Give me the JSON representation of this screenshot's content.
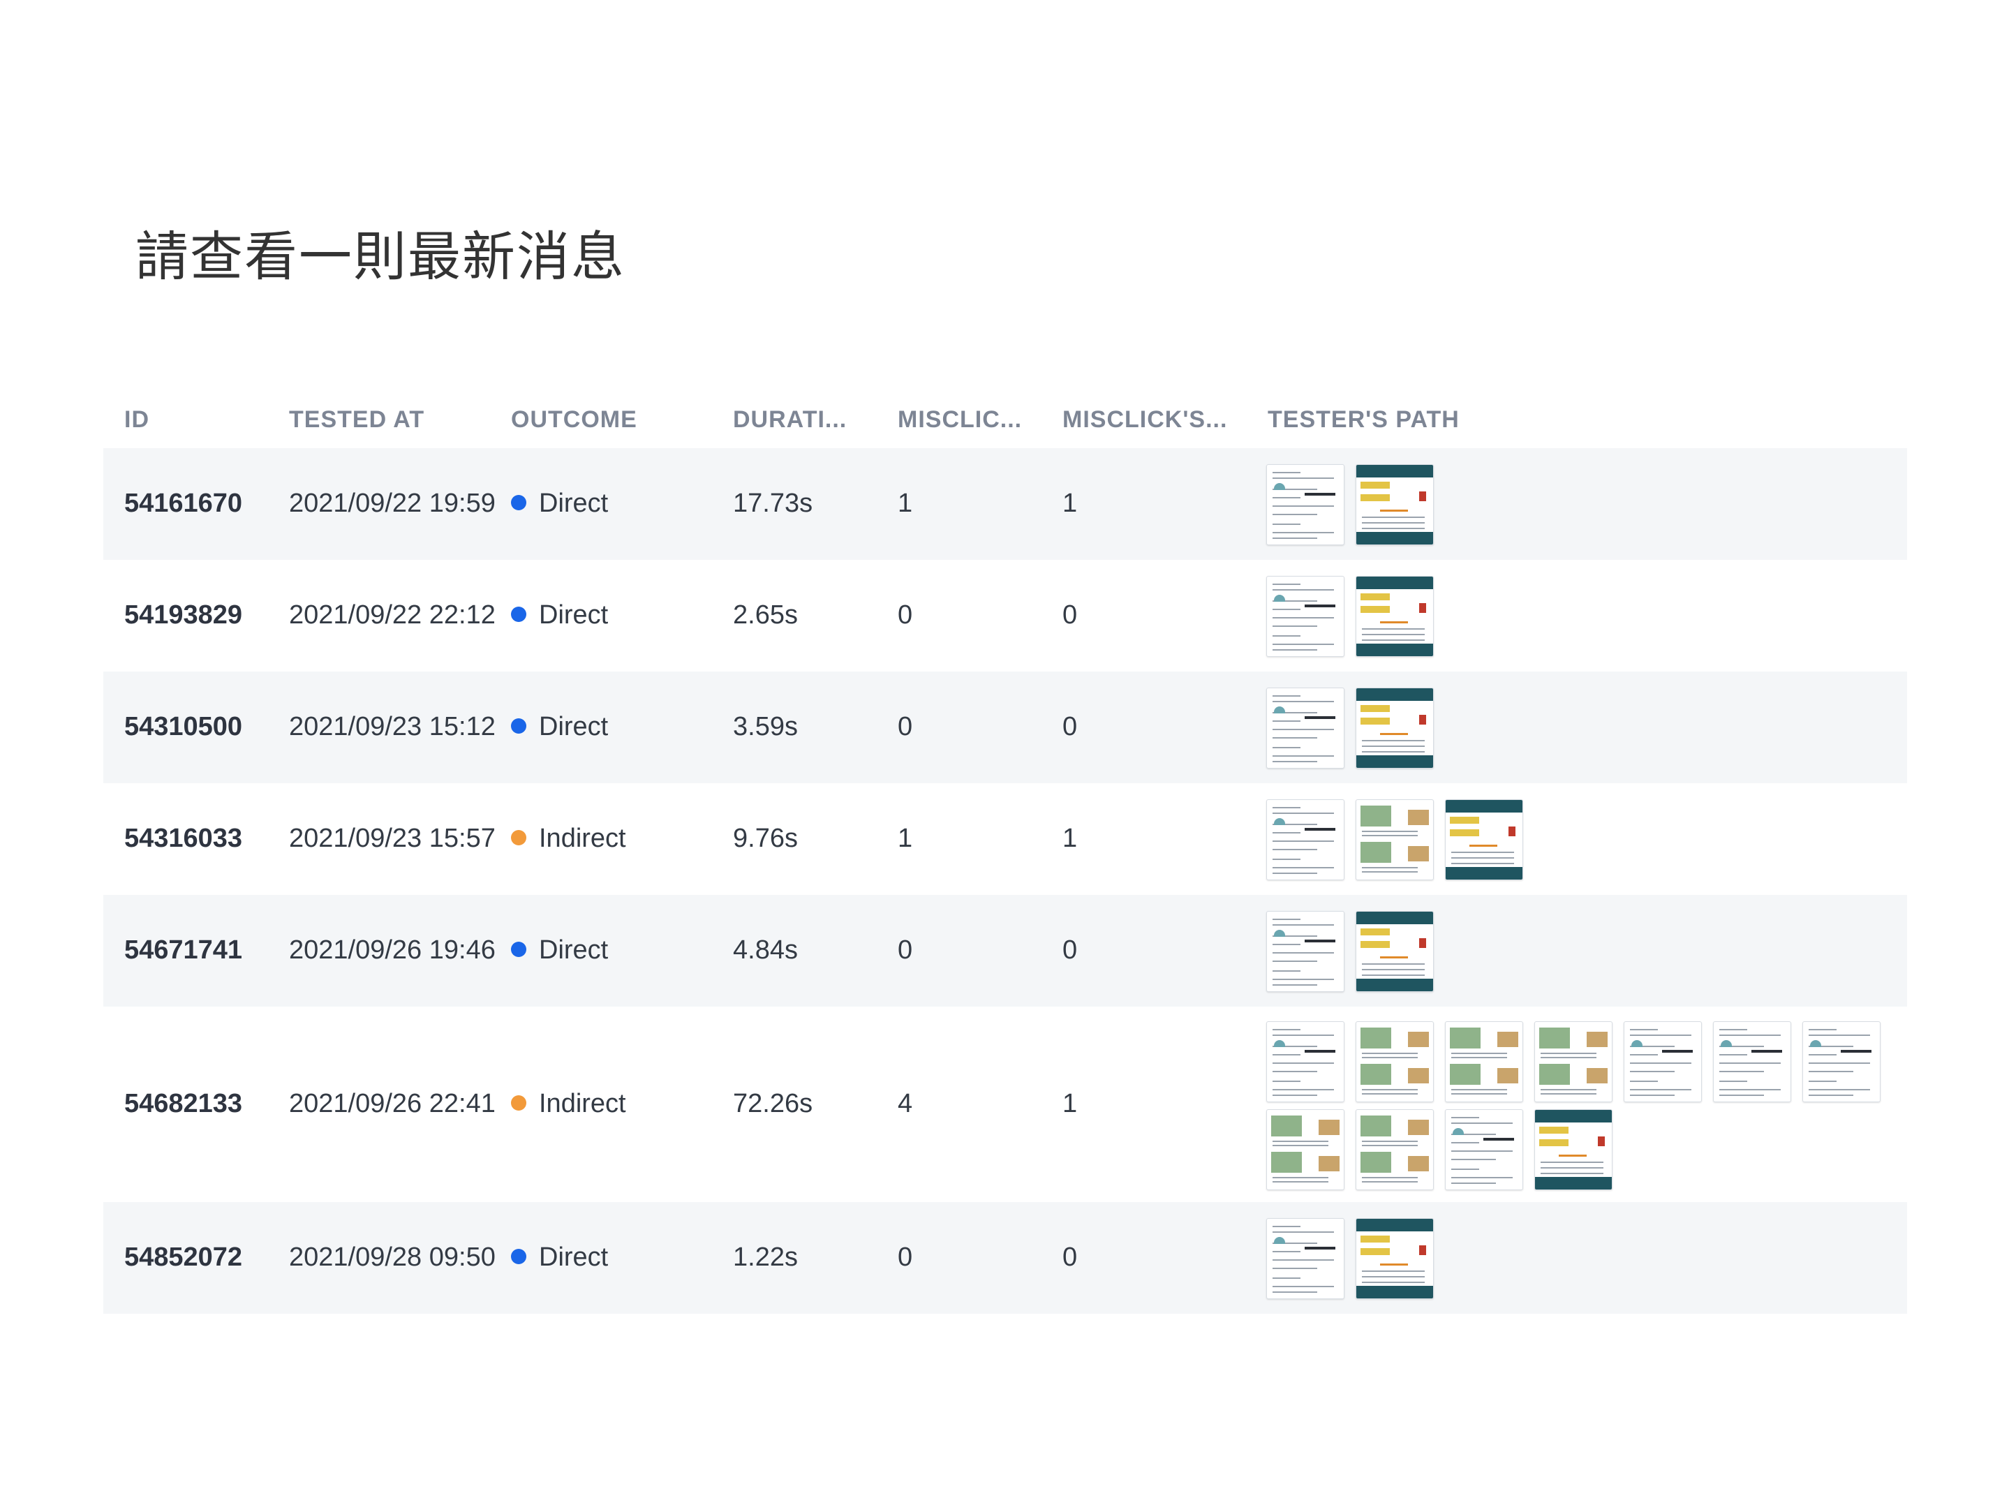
{
  "title": "請查看一則最新消息",
  "columns": {
    "id": "ID",
    "tested_at": "TESTED AT",
    "outcome": "OUTCOME",
    "duration": "DURATI...",
    "misclicks": "MISCLIC...",
    "misclick_s": "MISCLICK'S...",
    "path": "TESTER'S PATH"
  },
  "colors": {
    "direct": "#1a66e8",
    "indirect": "#f29a3a",
    "row_tint": "#f4f6f8",
    "header": "#7d8594"
  },
  "rows": [
    {
      "id": "54161670",
      "tested_at": "2021/09/22 19:59",
      "outcome": "Direct",
      "duration": "17.73s",
      "misclicks": "1",
      "misclick_s": "1",
      "path": [
        "light",
        "dark"
      ]
    },
    {
      "id": "54193829",
      "tested_at": "2021/09/22 22:12",
      "outcome": "Direct",
      "duration": "2.65s",
      "misclicks": "0",
      "misclick_s": "0",
      "path": [
        "light",
        "dark"
      ]
    },
    {
      "id": "54310500",
      "tested_at": "2021/09/23 15:12",
      "outcome": "Direct",
      "duration": "3.59s",
      "misclicks": "0",
      "misclick_s": "0",
      "path": [
        "light",
        "dark"
      ]
    },
    {
      "id": "54316033",
      "tested_at": "2021/09/23 15:57",
      "outcome": "Indirect",
      "duration": "9.76s",
      "misclicks": "1",
      "misclick_s": "1",
      "path": [
        "light",
        "photo",
        "dark"
      ]
    },
    {
      "id": "54671741",
      "tested_at": "2021/09/26 19:46",
      "outcome": "Direct",
      "duration": "4.84s",
      "misclicks": "0",
      "misclick_s": "0",
      "path": [
        "light",
        "dark"
      ]
    },
    {
      "id": "54682133",
      "tested_at": "2021/09/26 22:41",
      "outcome": "Indirect",
      "duration": "72.26s",
      "misclicks": "4",
      "misclick_s": "1",
      "path": [
        "light",
        "photo",
        "photo",
        "photo",
        "light",
        "light",
        "light",
        "photo",
        "photo",
        "light",
        "dark"
      ]
    },
    {
      "id": "54852072",
      "tested_at": "2021/09/28 09:50",
      "outcome": "Direct",
      "duration": "1.22s",
      "misclicks": "0",
      "misclick_s": "0",
      "path": [
        "light",
        "dark"
      ]
    }
  ]
}
